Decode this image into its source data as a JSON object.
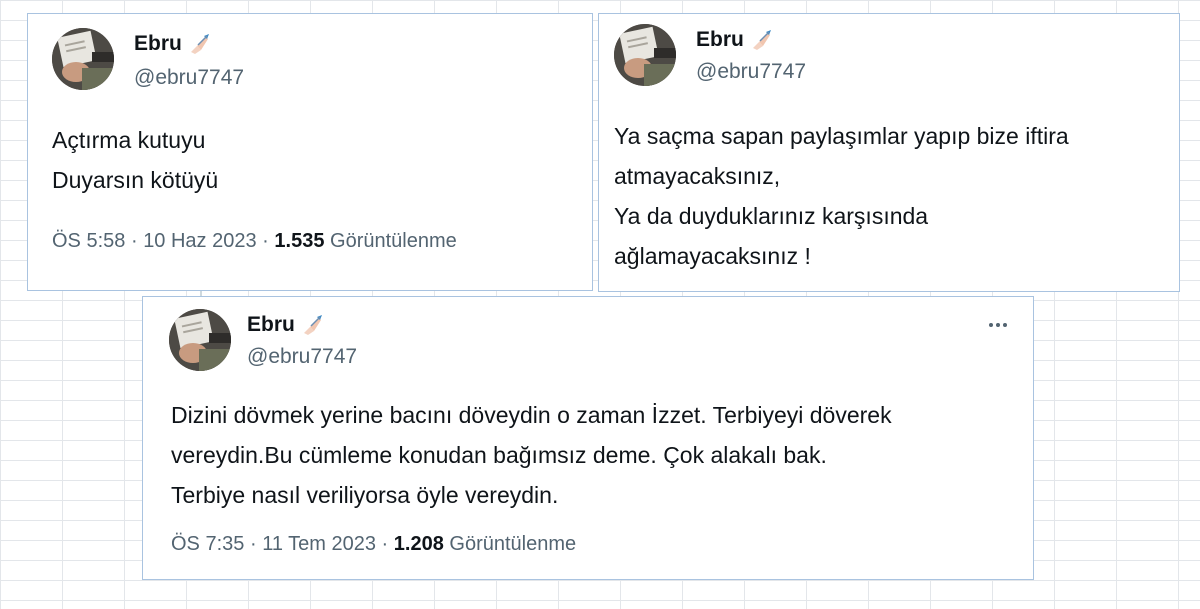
{
  "tweets": [
    {
      "name": "Ebru",
      "handle": "@ebru7747",
      "lines": [
        "Açtırma kutuyu",
        "Duyarsın kötüyü"
      ],
      "time": "ÖS 5:58",
      "date": "10 Haz 2023",
      "views_count": "1.535",
      "views_label": "Görüntülenme"
    },
    {
      "name": "Ebru",
      "handle": "@ebru7747",
      "lines": [
        "Ya saçma sapan paylaşımlar yapıp bize iftira",
        "atmayacaksınız,",
        "Ya da duyduklarınız karşısında",
        "ağlamayacaksınız !"
      ]
    },
    {
      "name": "Ebru",
      "handle": "@ebru7747",
      "lines": [
        "Dizini dövmek yerine bacını döveydin o zaman İzzet. Terbiyeyi döverek",
        "vereydin.Bu cümleme konudan bağımsız deme. Çok alakalı bak.",
        "Terbiye nasıl veriliyorsa öyle vereydin."
      ],
      "time": "ÖS 7:35",
      "date": "11 Tem 2023",
      "views_count": "1.208",
      "views_label": "Görüntülenme"
    }
  ],
  "separator": "·",
  "name_emoji": "writing-hand-icon",
  "menu_icon": "more-options-icon",
  "colors": {
    "border": "#a9c3e0",
    "text": "#0f1419",
    "muted": "#536471"
  }
}
